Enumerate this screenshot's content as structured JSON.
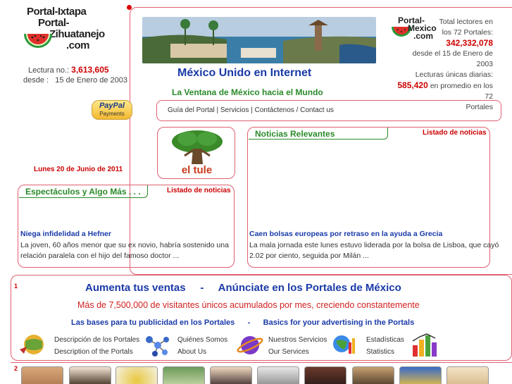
{
  "logo": {
    "line1": "Portal-Ixtapa",
    "line2": "Portal-",
    "line3": "Zihuatanejo",
    "line4": ".com"
  },
  "counter_left": {
    "label": "Lectura no.:",
    "value": "3,613,605",
    "since_label": "desde :",
    "since_value": "15 de Enero de 2003"
  },
  "right_logo": {
    "line1": "Portal-",
    "line2": "Mexico",
    "line3": ".com"
  },
  "stats_right": {
    "line1": "Total lectores en",
    "line2": "los 72 Portales:",
    "total": "342,332,078",
    "since": "desde el 15 de Enero de 2003",
    "unique_label": "Lecturas únicas diarias:",
    "unique_value": "585,420",
    "unique_suffix": "en promedio en los 72",
    "unique_suffix2": "Portales"
  },
  "header": {
    "title": "México Unido en Internet",
    "subtitle": "La Ventana de México hacia el Mundo"
  },
  "paypal": {
    "line1": "PayPal",
    "line2": "Payments"
  },
  "nav": {
    "items": [
      "Guía del Portal",
      "Servicios",
      "Contáctenos / Contact us"
    ],
    "sep": "|"
  },
  "tule_label": "el tule",
  "date": "Lunes 20 de Junio de 2011",
  "noticias": {
    "title": "Noticias Relevantes",
    "listado": "Listado de noticias",
    "headline": "Caen bolsas europeas por retraso en la ayuda a Grecia",
    "text1": "La mala jornada este lunes estuvo liderada por la bolsa de Lisboa, que cayó",
    "text2": "2.02 por ciento, seguida por Milán ..."
  },
  "espectaculos": {
    "title": "Espectáculos y Algo Más . . .",
    "listado": "Listado de noticias",
    "headline": "Niega infidelidad a Hefner",
    "text1": "La joven, 60 años menor que su ex novio, habría sostenido una",
    "text2": "relación paralela con el hijo del famoso doctor ..."
  },
  "ad": {
    "number": "1",
    "headline_left": "Aumenta tus ventas",
    "dash": "-",
    "headline_right": "Anúnciate en los Portales de México",
    "visitors": "Más de 7,500,000 de visitantes únicos acumulados por mes, creciendo constantemente",
    "bases_left": "Las bases para tu publicidad en los Portales",
    "bases_dash": "-",
    "bases_right": "Basics for your advertising in the Portals",
    "links": [
      {
        "es": "Descripción de los Portales",
        "en": "Description of the Portals"
      },
      {
        "es": "Quiénes Somos",
        "en": "About Us"
      },
      {
        "es": "Nuestros Servicios",
        "en": "Our Services"
      },
      {
        "es": "Estadísticas",
        "en": "Statistics"
      }
    ]
  },
  "bottom_number": "2",
  "colors": {
    "frame": "#e06070",
    "blue": "#1a3aa8",
    "green": "#2a8a2a",
    "red": "#cc0000"
  }
}
